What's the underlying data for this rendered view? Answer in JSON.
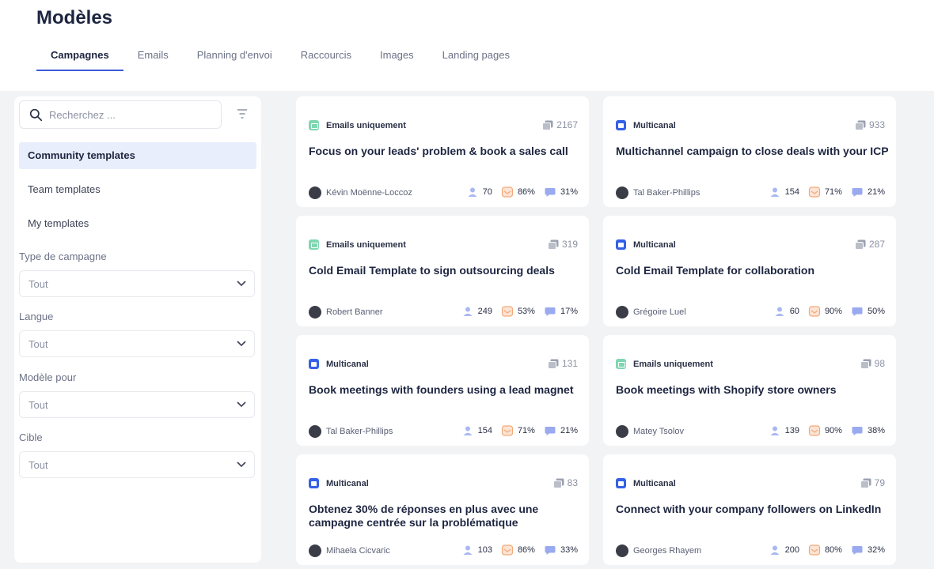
{
  "page": {
    "title": "Modèles"
  },
  "tabs": [
    {
      "label": "Campagnes"
    },
    {
      "label": "Emails"
    },
    {
      "label": "Planning d'envoi"
    },
    {
      "label": "Raccourcis"
    },
    {
      "label": "Images"
    },
    {
      "label": "Landing pages"
    }
  ],
  "sidebar": {
    "search_placeholder": "Recherchez ...",
    "items": [
      {
        "label": "Community templates"
      },
      {
        "label": "Team templates"
      },
      {
        "label": "My templates"
      }
    ],
    "filters": [
      {
        "label": "Type de campagne",
        "value": "Tout"
      },
      {
        "label": "Langue",
        "value": "Tout"
      },
      {
        "label": "Modèle pour",
        "value": "Tout"
      },
      {
        "label": "Cible",
        "value": "Tout"
      }
    ]
  },
  "cards": [
    {
      "tag": "Emails uniquement",
      "count": "2167",
      "title": "Focus on your leads' problem & book a sales call",
      "author": "Kévin Moënne-Loccoz",
      "leads": "70",
      "opens": "86%",
      "replies": "31%"
    },
    {
      "tag": "Multicanal",
      "count": "933",
      "title": "Multichannel campaign to close deals with your ICP",
      "author": "Tal Baker-Phillips",
      "leads": "154",
      "opens": "71%",
      "replies": "21%"
    },
    {
      "tag": "Emails uniquement",
      "count": "319",
      "title": "Cold Email Template to sign outsourcing deals",
      "author": "Robert Banner",
      "leads": "249",
      "opens": "53%",
      "replies": "17%"
    },
    {
      "tag": "Multicanal",
      "count": "287",
      "title": "Cold Email Template for collaboration",
      "author": "Grégoire Luel",
      "leads": "60",
      "opens": "90%",
      "replies": "50%"
    },
    {
      "tag": "Multicanal",
      "count": "131",
      "title": "Book meetings with founders using a lead magnet",
      "author": "Tal Baker-Phillips",
      "leads": "154",
      "opens": "71%",
      "replies": "21%"
    },
    {
      "tag": "Emails uniquement",
      "count": "98",
      "title": "Book meetings with Shopify store owners",
      "author": "Matey Tsolov",
      "leads": "139",
      "opens": "90%",
      "replies": "38%"
    },
    {
      "tag": "Multicanal",
      "count": "83",
      "title": "Obtenez 30% de réponses en plus avec une campagne centrée sur la problématique",
      "author": "Mihaela Cicvaric",
      "leads": "103",
      "opens": "86%",
      "replies": "33%"
    },
    {
      "tag": "Multicanal",
      "count": "79",
      "title": "Connect with your company followers on LinkedIn",
      "author": "Georges Rhayem",
      "leads": "200",
      "opens": "80%",
      "replies": "32%"
    }
  ],
  "colors": {
    "accent": "#3b5bdb",
    "email_tag": "#7fd6b0",
    "multi_tag": "#3561e6",
    "leads_icon": "#a9b8f2",
    "opens_icon": "#f2a97a",
    "replies_icon": "#9aaaf0"
  }
}
